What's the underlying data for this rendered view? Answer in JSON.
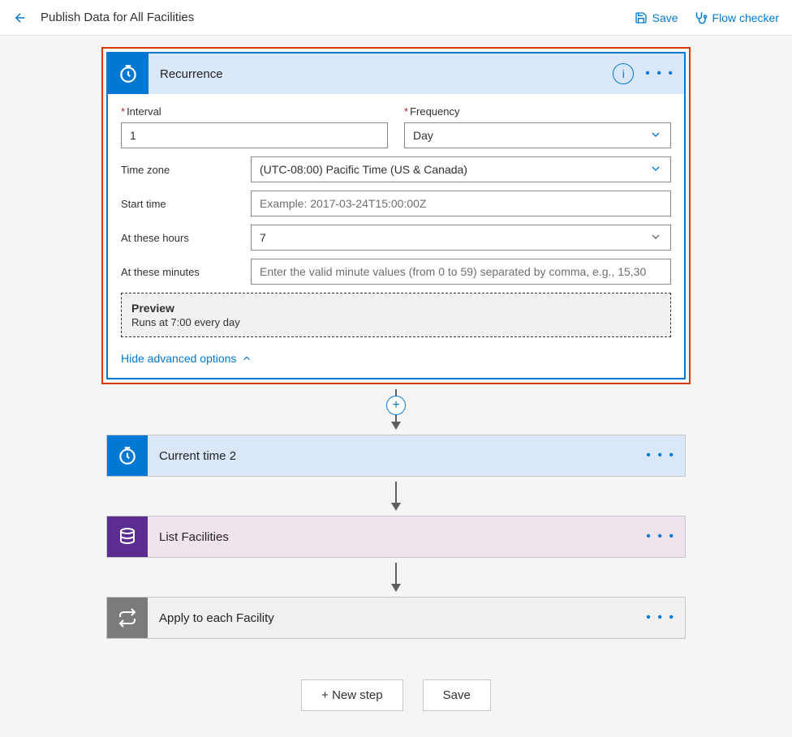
{
  "topbar": {
    "title": "Publish Data for All Facilities",
    "save_label": "Save",
    "flow_checker_label": "Flow checker"
  },
  "recurrence": {
    "title": "Recurrence",
    "interval_label": "Interval",
    "interval_value": "1",
    "frequency_label": "Frequency",
    "frequency_value": "Day",
    "tz_label": "Time zone",
    "tz_value": "(UTC-08:00) Pacific Time (US & Canada)",
    "start_label": "Start time",
    "start_placeholder": "Example: 2017-03-24T15:00:00Z",
    "hours_label": "At these hours",
    "hours_value": "7",
    "minutes_label": "At these minutes",
    "minutes_placeholder": "Enter the valid minute values (from 0 to 59) separated by comma, e.g., 15,30",
    "preview_title": "Preview",
    "preview_text": "Runs at 7:00 every day",
    "advanced_toggle": "Hide advanced options"
  },
  "steps": {
    "current_time": "Current time 2",
    "list_facilities": "List Facilities",
    "apply_each": "Apply to each Facility"
  },
  "bottom": {
    "new_step": "+ New step",
    "save": "Save"
  },
  "more_label": "• • •",
  "info_label": "i",
  "plus_label": "+"
}
